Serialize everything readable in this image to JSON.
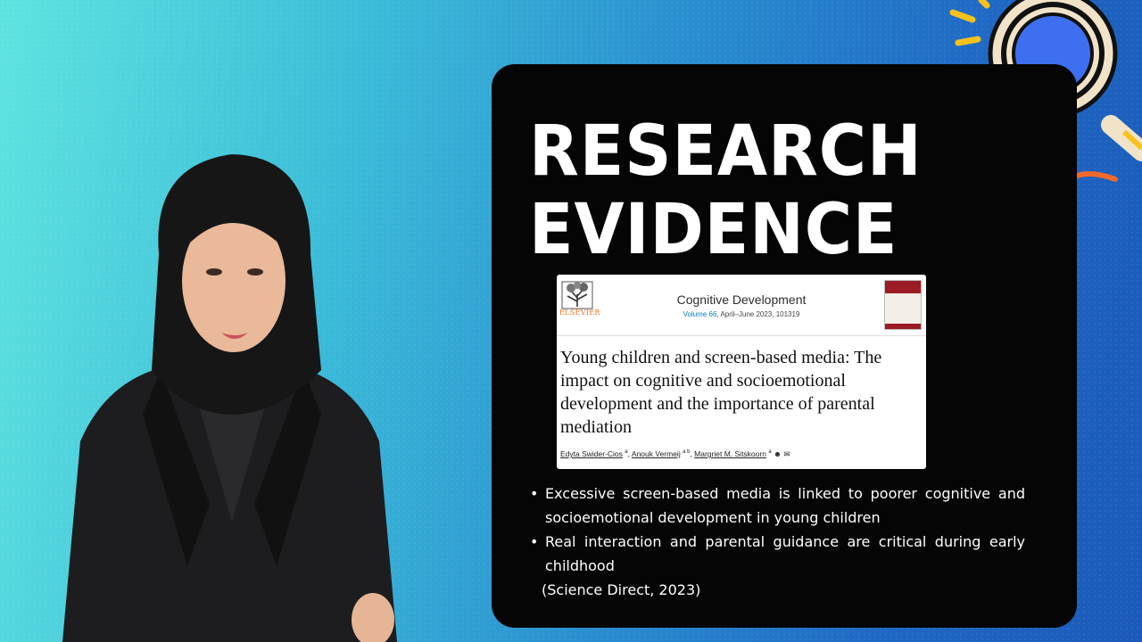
{
  "slide": {
    "heading_line1": "RESEARCH",
    "heading_line2": "EVIDENCE"
  },
  "paper": {
    "publisher": "ELSEVIER",
    "journal": "Cognitive Development",
    "volume": "Volume 66",
    "issue_detail": ", April–June 2023, 101319",
    "title": "Young children and screen-based media: The impact on cognitive and socioemotional development and the importance of parental mediation",
    "author1": "Edyta Swider-Cios",
    "author1_sup": "a",
    "author2": "Anouk Vermeij",
    "author2_sup": "a b",
    "author3": "Margriet M. Sitskoorn",
    "author3_sup": "a"
  },
  "bullets": [
    "Excessive screen-based media is linked to poorer cognitive and socioemotional development in young children",
    "Real interaction and parental guidance are critical during early childhood"
  ],
  "citation": "(Science Direct, 2023)",
  "colors": {
    "card": "#050505",
    "accent_orange": "#ef6a2c",
    "accent_yellow": "#f7c21b",
    "magnifier_lens": "#3e6ff0"
  }
}
